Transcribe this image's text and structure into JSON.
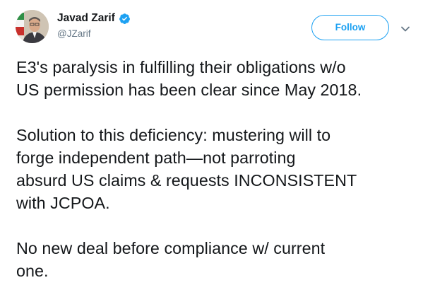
{
  "author": {
    "display_name": "Javad Zarif",
    "handle": "@JZarif",
    "verified_icon": "verified-badge-icon",
    "avatar": "profile-photo"
  },
  "actions": {
    "follow_label": "Follow",
    "more_icon": "chevron-down-icon"
  },
  "tweet": {
    "paragraphs": [
      "E3's paralysis in fulfilling their obligations w/o\nUS permission has been clear since May 2018.",
      "Solution to this deficiency: mustering will to\nforge independent path—not parroting\nabsurd US claims & requests INCONSISTENT\nwith JCPOA.",
      "No new deal before compliance w/ current\none."
    ]
  },
  "colors": {
    "accent": "#1da1f2",
    "text": "#14171a",
    "secondary_text": "#657786"
  }
}
